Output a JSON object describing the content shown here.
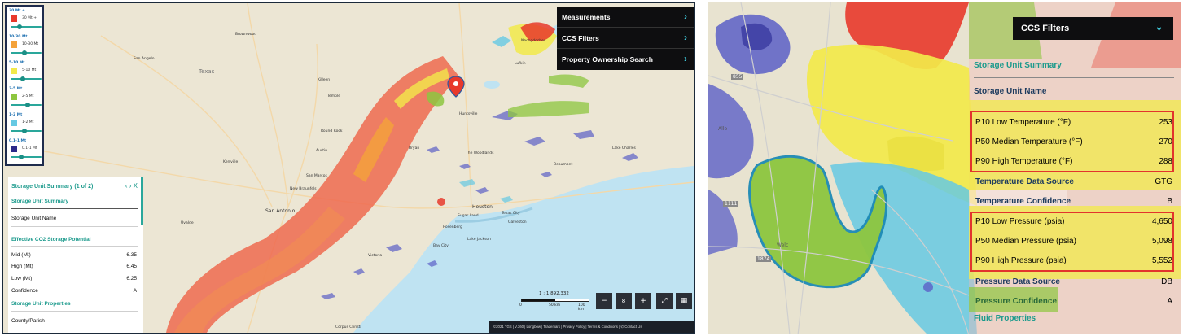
{
  "left_panel": {
    "legend": [
      {
        "range": "30 Mt +",
        "value": "30 Mt +",
        "color": "#e8392b",
        "knob": 0.3
      },
      {
        "range": "10-30 Mt",
        "value": "10-30 Mt",
        "color": "#f4a23a",
        "knob": 0.45
      },
      {
        "range": "5-10 Mt",
        "value": "5-10 Mt",
        "color": "#f2e94a",
        "knob": 0.4
      },
      {
        "range": "2-5 Mt",
        "value": "2-5 Mt",
        "color": "#8dc63f",
        "knob": 0.55
      },
      {
        "range": "1-2 Mt",
        "value": "1-2 Mt",
        "color": "#66c9e3",
        "knob": 0.45
      },
      {
        "range": "0.1-1 Mt",
        "value": "0.1-1 Mt",
        "color": "#2c2a8a",
        "knob": 0.35
      }
    ],
    "menu": [
      {
        "label": "Measurements",
        "chev": "›"
      },
      {
        "label": "CCS Filters",
        "chev": "›"
      },
      {
        "label": "Property Ownership Search",
        "chev": "›"
      }
    ],
    "summary": {
      "header": "Storage Unit Summary (1 of 2)",
      "nav": "‹ › X",
      "subheader": "Storage Unit Summary",
      "name_label": "Storage Unit Name",
      "section_potential": "Effective CO2 Storage Potential",
      "rows": [
        {
          "label": "Mid (Mt)",
          "value": "6.35"
        },
        {
          "label": "High (Mt)",
          "value": "6.45"
        },
        {
          "label": "Low (Mt)",
          "value": "6.25"
        },
        {
          "label": "Confidence",
          "value": "A"
        }
      ],
      "section_properties": "Storage Unit Properties",
      "county_label": "County/Parish"
    },
    "scale": {
      "ratio": "1 : 1,892,332",
      "zero": "0",
      "mid": "50 km",
      "end": "100 km"
    },
    "controls": {
      "zoom_out": "−",
      "zoom_level": "8",
      "zoom_in": "+",
      "fullscreen": "⤢",
      "qr": "▦"
    },
    "footer": "©2021 TGS  |  V.360  |  Longbow  |  Trademark  |  Privacy Policy  |  Terms & Conditions  |  ✆  Contact Us",
    "places": [
      {
        "name": "Texas",
        "big": true
      },
      {
        "name": "Brownwood"
      },
      {
        "name": "San Angelo"
      },
      {
        "name": "Killeen"
      },
      {
        "name": "Temple"
      },
      {
        "name": "Round Rock"
      },
      {
        "name": "Austin"
      },
      {
        "name": "Kerrville"
      },
      {
        "name": "San Marcos"
      },
      {
        "name": "New Braunfels"
      },
      {
        "name": "San Antonio"
      },
      {
        "name": "Uvalde"
      },
      {
        "name": "Bryan"
      },
      {
        "name": "Huntsville"
      },
      {
        "name": "The Woodlands"
      },
      {
        "name": "Houston"
      },
      {
        "name": "Sugar Land"
      },
      {
        "name": "Rosenberg"
      },
      {
        "name": "Texas City"
      },
      {
        "name": "Galveston"
      },
      {
        "name": "Beaumont"
      },
      {
        "name": "Lake Charles"
      },
      {
        "name": "Victoria"
      },
      {
        "name": "Bay City"
      },
      {
        "name": "Lake Jackson"
      },
      {
        "name": "Lufkin"
      },
      {
        "name": "Nacogdoches"
      },
      {
        "name": "Corpus Christi"
      }
    ]
  },
  "right_panel": {
    "ccs_filters": {
      "label": "CCS Filters",
      "chev": "⌄"
    },
    "summary_title": "Storage Unit Summary",
    "unit_name_label": "Storage Unit Name",
    "temperature_rows": [
      {
        "label": "P10 Low Temperature (°F)",
        "value": "253"
      },
      {
        "label": "P50 Median Temperature (°F)",
        "value": "270"
      },
      {
        "label": "P90 High Temperature (°F)",
        "value": "288"
      }
    ],
    "temp_meta": [
      {
        "label": "Temperature Data Source",
        "value": "GTG"
      },
      {
        "label": "Temperature Confidence",
        "value": "B"
      }
    ],
    "pressure_rows": [
      {
        "label": "P10 Low Pressure (psia)",
        "value": "4,650"
      },
      {
        "label": "P50 Median Pressure (psia)",
        "value": "5,098"
      },
      {
        "label": "P90 High Pressure (psia)",
        "value": "5,552"
      }
    ],
    "pressure_meta": [
      {
        "label": "Pressure Data Source",
        "value": "DB"
      },
      {
        "label": "Pressure Confidence",
        "value": "A"
      }
    ],
    "fluid_section": "Fluid Properties",
    "map_labels": {
      "place1": "Allo",
      "place2": "Welc",
      "road1": "855",
      "road2": "1111",
      "road3": "1874"
    }
  }
}
